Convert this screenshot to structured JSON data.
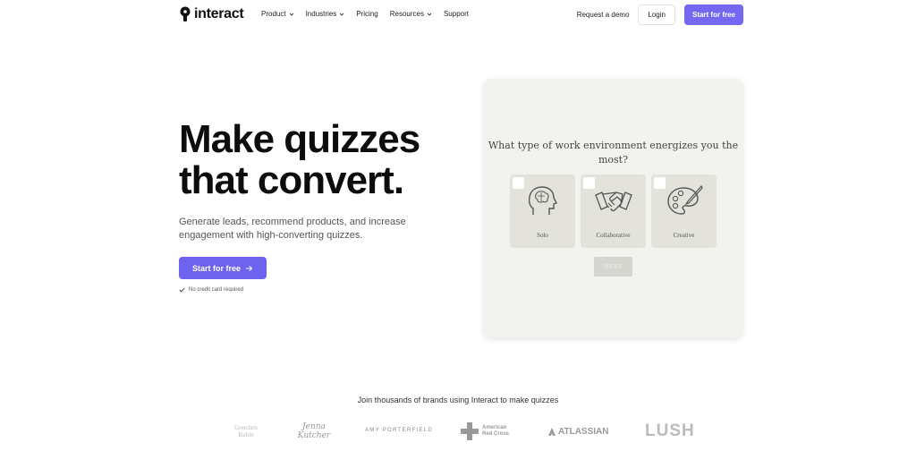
{
  "nav": {
    "logo_text": "interact",
    "menu": [
      {
        "label": "Product",
        "has_dropdown": true
      },
      {
        "label": "Industries",
        "has_dropdown": true
      },
      {
        "label": "Pricing",
        "has_dropdown": false
      },
      {
        "label": "Resources",
        "has_dropdown": true
      },
      {
        "label": "Support",
        "has_dropdown": false
      }
    ],
    "request_demo": "Request a demo",
    "login": "Login",
    "start_free": "Start for free"
  },
  "hero": {
    "title_line1": "Make quizzes",
    "title_line2": "that convert.",
    "subtitle": "Generate leads, recommend products, and increase engagement with high-converting quizzes.",
    "cta": "Start for free",
    "no_credit_card": "No credit card required"
  },
  "quiz": {
    "question": "What type of work environment energizes you the most?",
    "options": [
      {
        "label": "Solo",
        "icon": "head-brain-icon"
      },
      {
        "label": "Collaborative",
        "icon": "handshake-icon"
      },
      {
        "label": "Creative",
        "icon": "palette-icon"
      }
    ],
    "next": "NEXT"
  },
  "brands": {
    "title": "Join thousands of brands using Interact to make quizzes",
    "logos": [
      "Gretchen Rubin",
      "Jenna Kutcher",
      "AMY PORTERFIELD",
      "American Red Cross",
      "ATLASSIAN",
      "LUSH"
    ]
  },
  "colors": {
    "accent": "#6e63ee",
    "card_bg": "#f2f2ef",
    "option_bg": "#e3e3dc"
  }
}
